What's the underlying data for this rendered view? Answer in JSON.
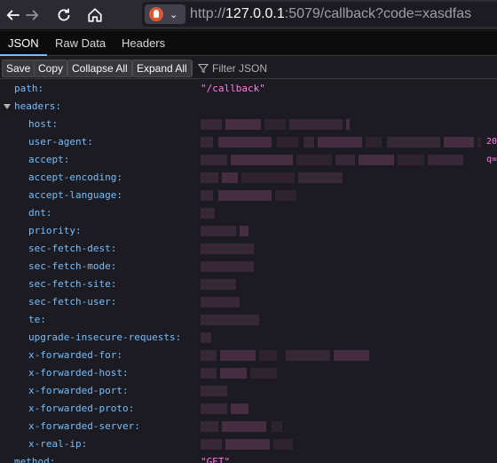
{
  "browser": {
    "url_host": "127.0.0.1",
    "url_rest": ":5079/callback?code=xasdfas",
    "url_prefix": "http://"
  },
  "tabs": [
    "JSON",
    "Raw Data",
    "Headers"
  ],
  "buttons": {
    "save": "Save",
    "copy": "Copy",
    "collapse_all": "Collapse All",
    "expand_all": "Expand All",
    "filter": "Filter JSON"
  },
  "tree": {
    "path": {
      "key": "path:",
      "value": "\"/callback\""
    },
    "headers_key": "headers:",
    "headers": [
      "host:",
      "user-agent:",
      "accept:",
      "accept-encoding:",
      "accept-language:",
      "dnt:",
      "priority:",
      "sec-fetch-dest:",
      "sec-fetch-mode:",
      "sec-fetch-site:",
      "sec-fetch-user:",
      "te:",
      "upgrade-insecure-requests:",
      "x-forwarded-for:",
      "x-forwarded-host:",
      "x-forwarded-port:",
      "x-forwarded-proto:",
      "x-forwarded-server:",
      "x-real-ip:"
    ],
    "edge_fragments": {
      "user_agent": "20",
      "accept": "q="
    },
    "method": {
      "key": "method:",
      "value": "\"GET\""
    }
  },
  "colors": {
    "key": "#75bfff",
    "string": "#ff7de9",
    "accent": "#75bfff"
  }
}
